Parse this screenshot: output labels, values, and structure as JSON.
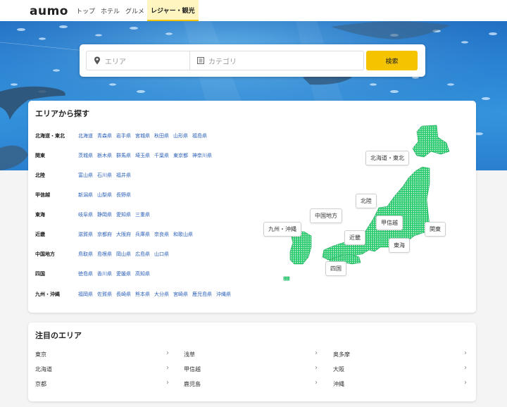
{
  "header": {
    "logo": "aumo",
    "nav": [
      {
        "label": "トップ"
      },
      {
        "label": "ホテル"
      },
      {
        "label": "グルメ"
      },
      {
        "label": "レジャー・観光"
      }
    ]
  },
  "search": {
    "area_placeholder": "エリア",
    "category_placeholder": "カテゴリ",
    "button_label": "検索"
  },
  "area_section": {
    "title": "エリアから探す",
    "regions": [
      {
        "name": "北海道・東北",
        "prefs": [
          "北海道",
          "青森県",
          "岩手県",
          "宮城県",
          "秋田県",
          "山形県",
          "福島県"
        ]
      },
      {
        "name": "関東",
        "prefs": [
          "茨城県",
          "栃木県",
          "群馬県",
          "埼玉県",
          "千葉県",
          "東京都",
          "神奈川県"
        ]
      },
      {
        "name": "北陸",
        "prefs": [
          "富山県",
          "石川県",
          "福井県"
        ]
      },
      {
        "name": "甲信越",
        "prefs": [
          "新潟県",
          "山梨県",
          "長野県"
        ]
      },
      {
        "name": "東海",
        "prefs": [
          "岐阜県",
          "静岡県",
          "愛知県",
          "三重県"
        ]
      },
      {
        "name": "近畿",
        "prefs": [
          "滋賀県",
          "京都府",
          "大阪府",
          "兵庫県",
          "奈良県",
          "和歌山県"
        ]
      },
      {
        "name": "中国地方",
        "prefs": [
          "鳥取県",
          "島根県",
          "岡山県",
          "広島県",
          "山口県"
        ]
      },
      {
        "name": "四国",
        "prefs": [
          "徳島県",
          "香川県",
          "愛媛県",
          "高知県"
        ]
      },
      {
        "name": "九州・沖縄",
        "prefs": [
          "福岡県",
          "佐賀県",
          "長崎県",
          "熊本県",
          "大分県",
          "宮崎県",
          "鹿児島県",
          "沖縄県"
        ]
      }
    ],
    "map_labels": {
      "hokkaido_tohoku": "北海道・東北",
      "hokuriku": "北陸",
      "chugoku": "中国地方",
      "koshinetsu": "甲信越",
      "kanto": "関東",
      "kyushu": "九州・沖縄",
      "kinki": "近畿",
      "tokai": "東海",
      "shikoku": "四国"
    },
    "map_color": "#2ecc71"
  },
  "featured": {
    "title": "注目のエリア",
    "items": [
      {
        "label": "東京"
      },
      {
        "label": "浅草"
      },
      {
        "label": "奥多摩"
      },
      {
        "label": "北海道"
      },
      {
        "label": "甲信越"
      },
      {
        "label": "大阪"
      },
      {
        "label": "京都"
      },
      {
        "label": "鹿児島"
      },
      {
        "label": "沖縄"
      }
    ],
    "chevron": "›"
  },
  "colors": {
    "accent": "#f5c400",
    "link": "#2a5fb8",
    "map_fill": "#2ecc71"
  }
}
